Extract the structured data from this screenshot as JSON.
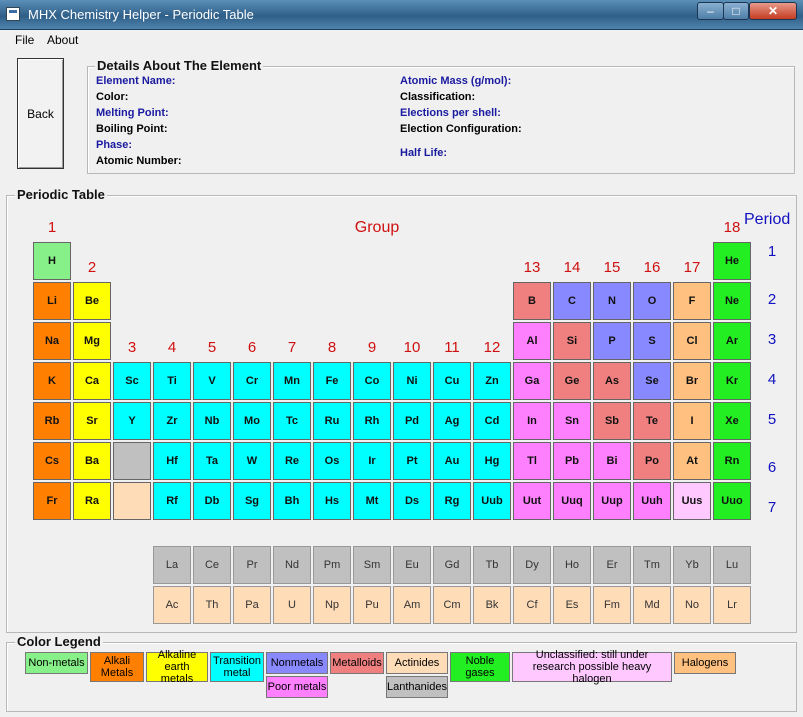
{
  "window": {
    "title": "MHX Chemistry Helper - Periodic Table",
    "min": "–",
    "max": "□",
    "close": "✕"
  },
  "menu": [
    "File",
    "About"
  ],
  "back_label": "Back",
  "details": {
    "title": "Details About The Element",
    "left": [
      {
        "label": "Element Name:",
        "blue": true
      },
      {
        "label": "Color:",
        "blue": false
      },
      {
        "label": "Melting Point:",
        "blue": true
      },
      {
        "label": "Boiling Point:",
        "blue": false
      },
      {
        "label": "Phase:",
        "blue": true
      },
      {
        "label": "Atomic Number:",
        "blue": false
      }
    ],
    "right": [
      {
        "label": "Atomic Mass (g/mol):",
        "blue": true
      },
      {
        "label": "Classification:",
        "blue": false
      },
      {
        "label": "Elections per shell:",
        "blue": true
      },
      {
        "label": "Election Configuration:",
        "blue": false
      },
      {
        "label": "Half Life:",
        "blue": true
      }
    ]
  },
  "periodic_table": {
    "title": "Periodic Table",
    "group_heading": "Group",
    "period_heading": "Period",
    "group_labels": [
      "1",
      "2",
      "3",
      "4",
      "5",
      "6",
      "7",
      "8",
      "9",
      "10",
      "11",
      "12",
      "13",
      "14",
      "15",
      "16",
      "17",
      "18"
    ],
    "period_labels": [
      "1",
      "2",
      "3",
      "4",
      "5",
      "6",
      "7"
    ],
    "elements": [
      {
        "s": "H",
        "c": "nonmetal",
        "col": 1,
        "row": 1
      },
      {
        "s": "He",
        "c": "noble",
        "col": 18,
        "row": 1
      },
      {
        "s": "Li",
        "c": "alkali",
        "col": 1,
        "row": 2
      },
      {
        "s": "Be",
        "c": "alkaline",
        "col": 2,
        "row": 2
      },
      {
        "s": "B",
        "c": "metalloid",
        "col": 13,
        "row": 2
      },
      {
        "s": "C",
        "c": "nonmetalb",
        "col": 14,
        "row": 2
      },
      {
        "s": "N",
        "c": "nonmetalb",
        "col": 15,
        "row": 2
      },
      {
        "s": "O",
        "c": "nonmetalb",
        "col": 16,
        "row": 2
      },
      {
        "s": "F",
        "c": "halogen",
        "col": 17,
        "row": 2
      },
      {
        "s": "Ne",
        "c": "noble",
        "col": 18,
        "row": 2
      },
      {
        "s": "Na",
        "c": "alkali",
        "col": 1,
        "row": 3
      },
      {
        "s": "Mg",
        "c": "alkaline",
        "col": 2,
        "row": 3
      },
      {
        "s": "Al",
        "c": "poor",
        "col": 13,
        "row": 3
      },
      {
        "s": "Si",
        "c": "metalloid",
        "col": 14,
        "row": 3
      },
      {
        "s": "P",
        "c": "nonmetalb",
        "col": 15,
        "row": 3
      },
      {
        "s": "S",
        "c": "nonmetalb",
        "col": 16,
        "row": 3
      },
      {
        "s": "Cl",
        "c": "halogen",
        "col": 17,
        "row": 3
      },
      {
        "s": "Ar",
        "c": "noble",
        "col": 18,
        "row": 3
      },
      {
        "s": "K",
        "c": "alkali",
        "col": 1,
        "row": 4
      },
      {
        "s": "Ca",
        "c": "alkaline",
        "col": 2,
        "row": 4
      },
      {
        "s": "Sc",
        "c": "transition",
        "col": 3,
        "row": 4
      },
      {
        "s": "Ti",
        "c": "transition",
        "col": 4,
        "row": 4
      },
      {
        "s": "V",
        "c": "transition",
        "col": 5,
        "row": 4
      },
      {
        "s": "Cr",
        "c": "transition",
        "col": 6,
        "row": 4
      },
      {
        "s": "Mn",
        "c": "transition",
        "col": 7,
        "row": 4
      },
      {
        "s": "Fe",
        "c": "transition",
        "col": 8,
        "row": 4
      },
      {
        "s": "Co",
        "c": "transition",
        "col": 9,
        "row": 4
      },
      {
        "s": "Ni",
        "c": "transition",
        "col": 10,
        "row": 4
      },
      {
        "s": "Cu",
        "c": "transition",
        "col": 11,
        "row": 4
      },
      {
        "s": "Zn",
        "c": "transition",
        "col": 12,
        "row": 4
      },
      {
        "s": "Ga",
        "c": "poor",
        "col": 13,
        "row": 4
      },
      {
        "s": "Ge",
        "c": "metalloid",
        "col": 14,
        "row": 4
      },
      {
        "s": "As",
        "c": "metalloid",
        "col": 15,
        "row": 4
      },
      {
        "s": "Se",
        "c": "nonmetalb",
        "col": 16,
        "row": 4
      },
      {
        "s": "Br",
        "c": "halogen",
        "col": 17,
        "row": 4
      },
      {
        "s": "Kr",
        "c": "noble",
        "col": 18,
        "row": 4
      },
      {
        "s": "Rb",
        "c": "alkali",
        "col": 1,
        "row": 5
      },
      {
        "s": "Sr",
        "c": "alkaline",
        "col": 2,
        "row": 5
      },
      {
        "s": "Y",
        "c": "transition",
        "col": 3,
        "row": 5
      },
      {
        "s": "Zr",
        "c": "transition",
        "col": 4,
        "row": 5
      },
      {
        "s": "Nb",
        "c": "transition",
        "col": 5,
        "row": 5
      },
      {
        "s": "Mo",
        "c": "transition",
        "col": 6,
        "row": 5
      },
      {
        "s": "Tc",
        "c": "transition",
        "col": 7,
        "row": 5
      },
      {
        "s": "Ru",
        "c": "transition",
        "col": 8,
        "row": 5
      },
      {
        "s": "Rh",
        "c": "transition",
        "col": 9,
        "row": 5
      },
      {
        "s": "Pd",
        "c": "transition",
        "col": 10,
        "row": 5
      },
      {
        "s": "Ag",
        "c": "transition",
        "col": 11,
        "row": 5
      },
      {
        "s": "Cd",
        "c": "transition",
        "col": 12,
        "row": 5
      },
      {
        "s": "In",
        "c": "poor",
        "col": 13,
        "row": 5
      },
      {
        "s": "Sn",
        "c": "poor",
        "col": 14,
        "row": 5
      },
      {
        "s": "Sb",
        "c": "metalloid",
        "col": 15,
        "row": 5
      },
      {
        "s": "Te",
        "c": "metalloid",
        "col": 16,
        "row": 5
      },
      {
        "s": "I",
        "c": "halogen",
        "col": 17,
        "row": 5
      },
      {
        "s": "Xe",
        "c": "noble",
        "col": 18,
        "row": 5
      },
      {
        "s": "Cs",
        "c": "alkali",
        "col": 1,
        "row": 6
      },
      {
        "s": "Ba",
        "c": "alkaline",
        "col": 2,
        "row": 6
      },
      {
        "s": "",
        "c": "lanthanide",
        "col": 3,
        "row": 6
      },
      {
        "s": "Hf",
        "c": "transition",
        "col": 4,
        "row": 6
      },
      {
        "s": "Ta",
        "c": "transition",
        "col": 5,
        "row": 6
      },
      {
        "s": "W",
        "c": "transition",
        "col": 6,
        "row": 6
      },
      {
        "s": "Re",
        "c": "transition",
        "col": 7,
        "row": 6
      },
      {
        "s": "Os",
        "c": "transition",
        "col": 8,
        "row": 6
      },
      {
        "s": "Ir",
        "c": "transition",
        "col": 9,
        "row": 6
      },
      {
        "s": "Pt",
        "c": "transition",
        "col": 10,
        "row": 6
      },
      {
        "s": "Au",
        "c": "transition",
        "col": 11,
        "row": 6
      },
      {
        "s": "Hg",
        "c": "transition",
        "col": 12,
        "row": 6
      },
      {
        "s": "Tl",
        "c": "poor",
        "col": 13,
        "row": 6
      },
      {
        "s": "Pb",
        "c": "poor",
        "col": 14,
        "row": 6
      },
      {
        "s": "Bi",
        "c": "poor",
        "col": 15,
        "row": 6
      },
      {
        "s": "Po",
        "c": "metalloid",
        "col": 16,
        "row": 6
      },
      {
        "s": "At",
        "c": "halogen",
        "col": 17,
        "row": 6
      },
      {
        "s": "Rn",
        "c": "noble",
        "col": 18,
        "row": 6
      },
      {
        "s": "Fr",
        "c": "alkali",
        "col": 1,
        "row": 7
      },
      {
        "s": "Ra",
        "c": "alkaline",
        "col": 2,
        "row": 7
      },
      {
        "s": "",
        "c": "actinide",
        "col": 3,
        "row": 7
      },
      {
        "s": "Rf",
        "c": "transition",
        "col": 4,
        "row": 7
      },
      {
        "s": "Db",
        "c": "transition",
        "col": 5,
        "row": 7
      },
      {
        "s": "Sg",
        "c": "transition",
        "col": 6,
        "row": 7
      },
      {
        "s": "Bh",
        "c": "transition",
        "col": 7,
        "row": 7
      },
      {
        "s": "Hs",
        "c": "transition",
        "col": 8,
        "row": 7
      },
      {
        "s": "Mt",
        "c": "transition",
        "col": 9,
        "row": 7
      },
      {
        "s": "Ds",
        "c": "transition",
        "col": 10,
        "row": 7
      },
      {
        "s": "Rg",
        "c": "transition",
        "col": 11,
        "row": 7
      },
      {
        "s": "Uub",
        "c": "transition",
        "col": 12,
        "row": 7
      },
      {
        "s": "Uut",
        "c": "poor",
        "col": 13,
        "row": 7
      },
      {
        "s": "Uuq",
        "c": "poor",
        "col": 14,
        "row": 7
      },
      {
        "s": "Uup",
        "c": "poor",
        "col": 15,
        "row": 7
      },
      {
        "s": "Uuh",
        "c": "poor",
        "col": 16,
        "row": 7
      },
      {
        "s": "Uus",
        "c": "unclassified",
        "col": 17,
        "row": 7
      },
      {
        "s": "Uuo",
        "c": "noble",
        "col": 18,
        "row": 7
      }
    ],
    "lanthanides": [
      "La",
      "Ce",
      "Pr",
      "Nd",
      "Pm",
      "Sm",
      "Eu",
      "Gd",
      "Tb",
      "Dy",
      "Ho",
      "Er",
      "Tm",
      "Yb",
      "Lu"
    ],
    "actinides": [
      "Ac",
      "Th",
      "Pa",
      "U",
      "Np",
      "Pu",
      "Am",
      "Cm",
      "Bk",
      "Cf",
      "Es",
      "Fm",
      "Md",
      "No",
      "Lr"
    ]
  },
  "colors": {
    "nonmetal": "#88f088",
    "noble": "#22ee22",
    "alkali": "#ff8000",
    "alkaline": "#ffff00",
    "transition": "#00ffff",
    "nonmetalb": "#8888ff",
    "metalloid": "#f08080",
    "poor": "#ff80ff",
    "halogen": "#ffc080",
    "lanthanide": "#c0c0c0",
    "actinide": "#ffdcb8",
    "unclassified": "#ffc8ff"
  },
  "legend": {
    "title": "Color Legend",
    "items": [
      {
        "label": "Non-metals",
        "c": "nonmetal"
      },
      {
        "label": "Alkali Metals",
        "c": "alkali"
      },
      {
        "label": "Alkaline earth metals",
        "c": "alkaline"
      },
      {
        "label": "Transition metal",
        "c": "transition"
      },
      {
        "label": "Nonmetals",
        "c": "nonmetalb"
      },
      {
        "label": "Metalloids",
        "c": "metalloid"
      },
      {
        "label": "Actinides",
        "c": "actinide"
      },
      {
        "label": "Noble gases",
        "c": "noble"
      },
      {
        "label": "Unclassified: still under research possible heavy  halogen",
        "c": "unclassified"
      },
      {
        "label": "Halogens",
        "c": "halogen"
      },
      {
        "label": "Poor metals",
        "c": "poor"
      },
      {
        "label": "Lanthanides",
        "c": "lanthanide"
      }
    ]
  }
}
